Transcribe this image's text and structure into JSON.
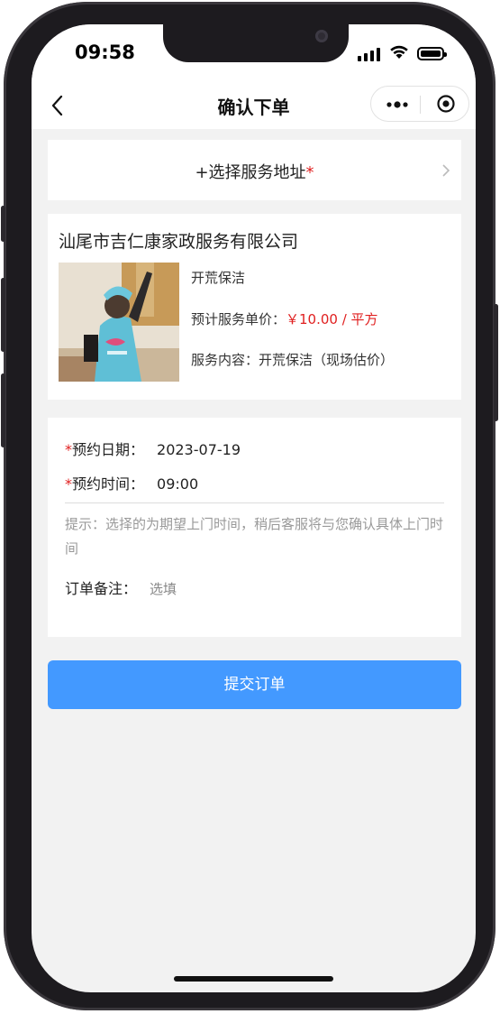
{
  "status_bar": {
    "time": "09:58"
  },
  "nav": {
    "title": "确认下单"
  },
  "address": {
    "label": "+选择服务地址",
    "required_mark": "*"
  },
  "service": {
    "company": "汕尾市吉仁康家政服务有限公司",
    "name": "开荒保洁",
    "price_label": "预计服务单价：",
    "price_value": "￥10.00 / 平方",
    "content_label": "服务内容：",
    "content_value": "开荒保洁（现场估价）"
  },
  "booking": {
    "date_label": "预约日期：",
    "date_value": "2023-07-19",
    "time_label": "预约时间：",
    "time_value": "09:00",
    "required_mark": "*",
    "tip": "提示：选择的为期望上门时间，稍后客服将与您确认具体上门时间",
    "remark_label": "订单备注：",
    "remark_placeholder": "选填"
  },
  "submit": {
    "label": "提交订单"
  },
  "colors": {
    "accent": "#4399ff",
    "price": "#e02020",
    "background": "#f2f2f2"
  }
}
